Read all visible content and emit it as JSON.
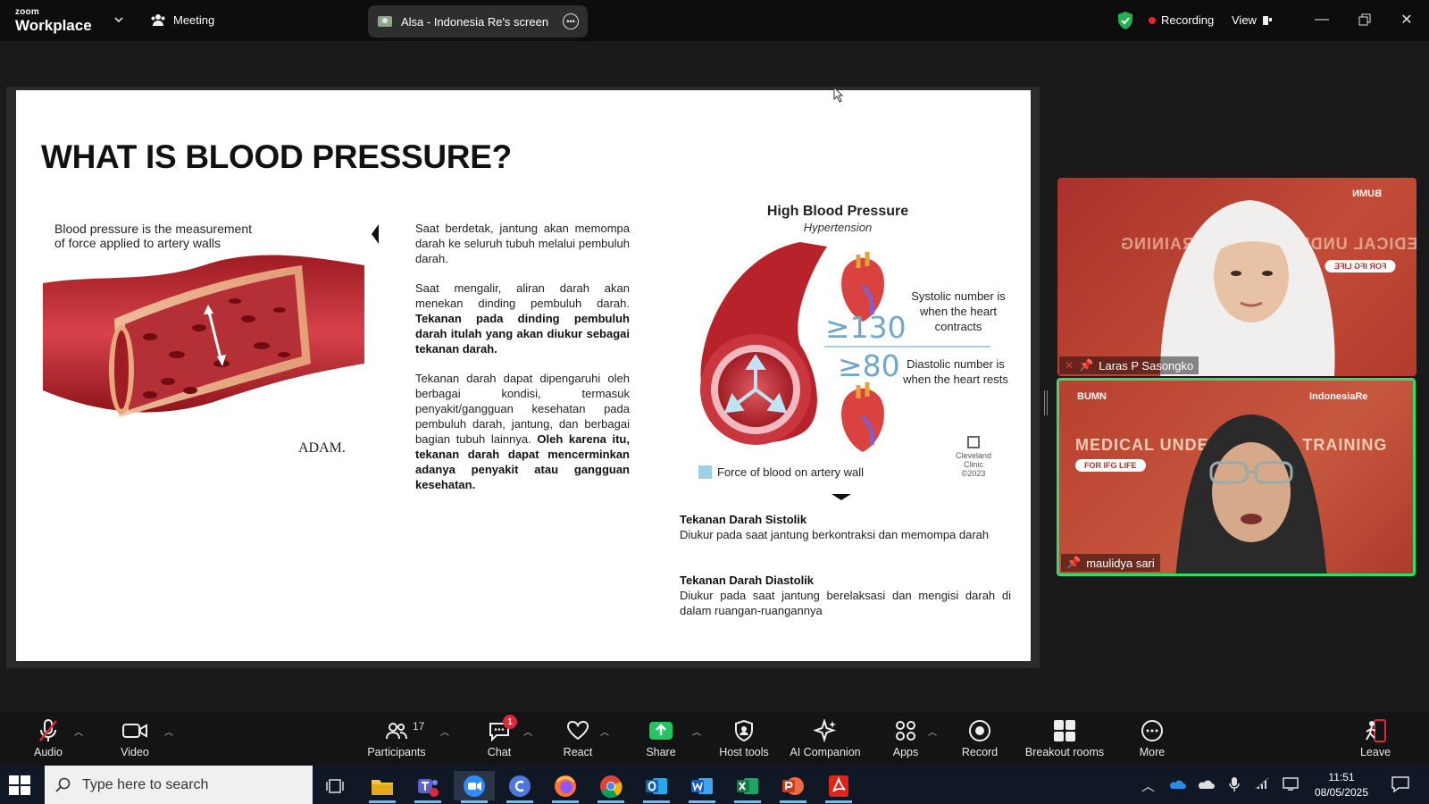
{
  "titlebar": {
    "brand_small": "zoom",
    "brand_big": "Workplace",
    "meeting_label": "Meeting",
    "screen_share_label": "Alsa - Indonesia Re's screen",
    "recording_label": "Recording",
    "view_label": "View",
    "recording_color": "#e02828",
    "secure_color": "#22b14c"
  },
  "slide": {
    "title": "WHAT IS BLOOD PRESSURE?",
    "vessel_caption_line1": "Blood pressure is the measurement",
    "vessel_caption_line2": "of force applied to artery walls",
    "adam_credit": "ADAM.",
    "para1": "Saat berdetak, jantung akan memompa darah ke seluruh tubuh melalui pembuluh darah.",
    "para2_normal": "Saat mengalir, aliran darah akan menekan dinding pembuluh darah. ",
    "para2_bold": "Tekanan pada dinding pembuluh darah itulah yang akan diukur sebagai tekanan darah.",
    "para3_normal": "Tekanan darah dapat dipengaruhi oleh berbagai kondisi, termasuk penyakit/gangguan kesehatan pada pembuluh darah, jantung, dan berbagai bagian tubuh lainnya. ",
    "para3_bold": "Oleh karena itu, tekanan darah dapat mencerminkan adanya penyakit atau gangguan kesehatan.",
    "hbp_title": "High Blood Pressure",
    "hbp_subtitle": "Hypertension",
    "systolic_value": "≥130",
    "diastolic_value": "≥80",
    "systolic_note": "Systolic number is when the heart contracts",
    "diastolic_note": "Diastolic number is when the heart rests",
    "legend_label": "Force of blood on artery wall",
    "legend_color": "#9fd0e8",
    "cleveland_line1": "Cleveland",
    "cleveland_line2": "Clinic",
    "cleveland_line3": "©2023",
    "def1_heading": "Tekanan Darah Sistolik",
    "def1_body": "Diukur pada saat jantung berkontraksi dan memompa darah",
    "def2_heading": "Tekanan Darah Diastolik",
    "def2_body": "Diukur pada saat jantung berelaksasi dan mengisi darah di dalam ruangan-ruangannya"
  },
  "participants": [
    {
      "name": "Laras P Sasongko",
      "muted": true
    },
    {
      "name": "maulidya sari",
      "muted": false,
      "speaking": true
    }
  ],
  "tile_banner": {
    "line1": "MEDICAL UNDERWRITING TRAINING",
    "pill": "FOR IFG LIFE",
    "logo_left": "BUMN",
    "logo_right": "IndonesiaRe"
  },
  "toolbar": {
    "audio": "Audio",
    "video": "Video",
    "participants": "Participants",
    "participants_count": "17",
    "chat": "Chat",
    "chat_badge": "1",
    "react": "React",
    "share": "Share",
    "host_tools": "Host tools",
    "ai_companion": "AI Companion",
    "apps": "Apps",
    "record": "Record",
    "breakout_rooms": "Breakout rooms",
    "more": "More",
    "leave": "Leave",
    "share_color": "#22c55e",
    "leave_color": "#e0263a"
  },
  "taskbar": {
    "search_placeholder": "Type here to search",
    "time": "11:51",
    "date": "08/05/2025",
    "apps": [
      "task-view",
      "file-explorer",
      "teams",
      "zoom",
      "canva",
      "firefox",
      "chrome",
      "outlook",
      "word",
      "excel",
      "powerpoint",
      "acrobat"
    ]
  }
}
